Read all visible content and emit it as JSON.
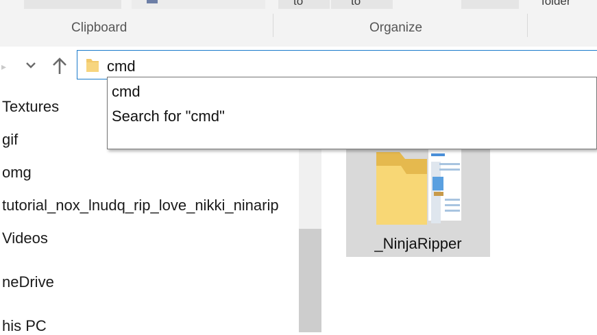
{
  "ribbon": {
    "fragments": [
      "to",
      "to",
      "folder"
    ],
    "groups": [
      "Clipboard",
      "Organize"
    ]
  },
  "address": {
    "value": "cmd",
    "icons": {
      "folder": "folder-icon",
      "back": "back-arrow-icon",
      "recent": "chevron-down-icon",
      "up": "up-arrow-icon"
    }
  },
  "suggestions": [
    "cmd",
    "Search for \"cmd\""
  ],
  "tree": {
    "items": [
      "Textures",
      "gif",
      "omg",
      "tutorial_nox_lnudq_rip_love_nikki_ninarip",
      "Videos",
      "neDrive",
      "his PC"
    ]
  },
  "content": {
    "items": [
      {
        "name": "_NinjaRipper",
        "icon": "folder-with-documents-icon"
      }
    ]
  },
  "colors": {
    "accent": "#1979ca",
    "selected_tile": "#d9d9d9"
  }
}
